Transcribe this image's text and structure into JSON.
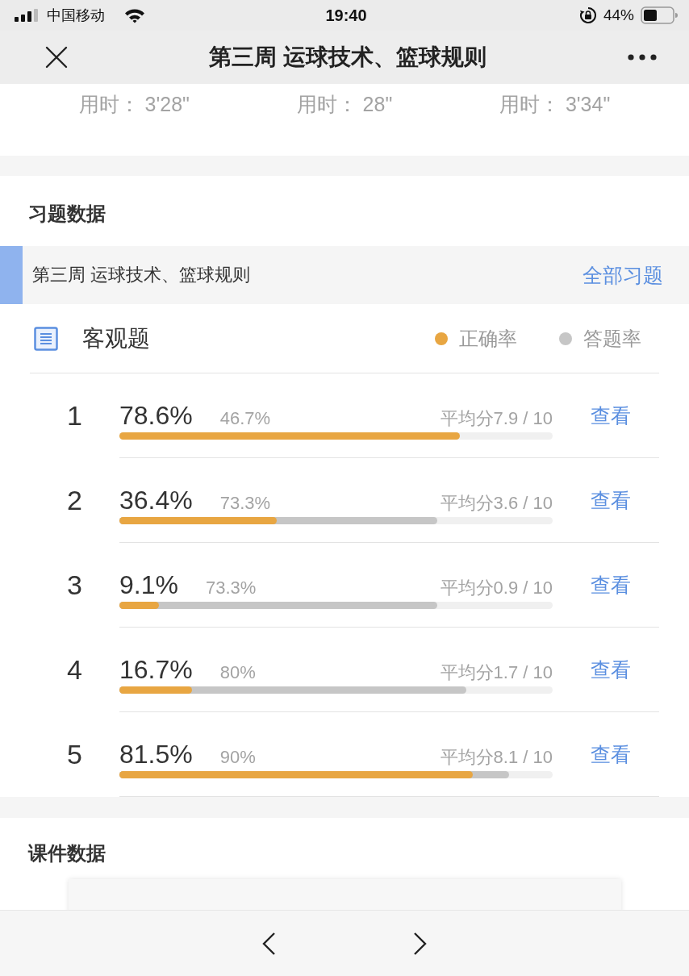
{
  "status_bar": {
    "carrier": "中国移动",
    "time": "19:40",
    "battery": "44%"
  },
  "nav_bar": {
    "title": "第三周 运球技术、篮球规则"
  },
  "durations": [
    "用时： 3'28\"",
    "用时： 28\"",
    "用时： 3'34\""
  ],
  "exercise_data": {
    "heading": "习题数据",
    "chapter": {
      "title": "第三周 运球技术、篮球规则",
      "link": "全部习题"
    },
    "objective": {
      "title": "客观题",
      "legend": [
        {
          "label": "正确率",
          "color": "#e8a642"
        },
        {
          "label": "答题率",
          "color": "#c6c6c6"
        }
      ],
      "questions": [
        {
          "number": "1",
          "correct": {
            "text": "78.6%",
            "level": 0.786
          },
          "answered": {
            "text": "46.7%"
          },
          "average": "平均分7.9 / 10",
          "action": "查看"
        },
        {
          "number": "2",
          "correct": {
            "text": "36.4%",
            "level": 0.364
          },
          "answered": {
            "text": "73.3%",
            "level": 0.733
          },
          "average": "平均分3.6 / 10",
          "action": "查看"
        },
        {
          "number": "3",
          "correct": {
            "text": "9.1%",
            "level": 0.091
          },
          "answered": {
            "text": "73.3%",
            "level": 0.733
          },
          "average": "平均分0.9 / 10",
          "action": "查看"
        },
        {
          "number": "4",
          "correct": {
            "text": "16.7%",
            "level": 0.167
          },
          "answered": {
            "text": "80%",
            "level": 0.8
          },
          "average": "平均分1.7 / 10",
          "action": "查看"
        },
        {
          "number": "5",
          "correct": {
            "text": "81.5%",
            "level": 0.815
          },
          "answered": {
            "text": "90%",
            "level": 0.9
          },
          "average": "平均分8.1 / 10",
          "action": "查看"
        }
      ]
    }
  },
  "courseware_data": {
    "heading": "课件数据"
  }
}
